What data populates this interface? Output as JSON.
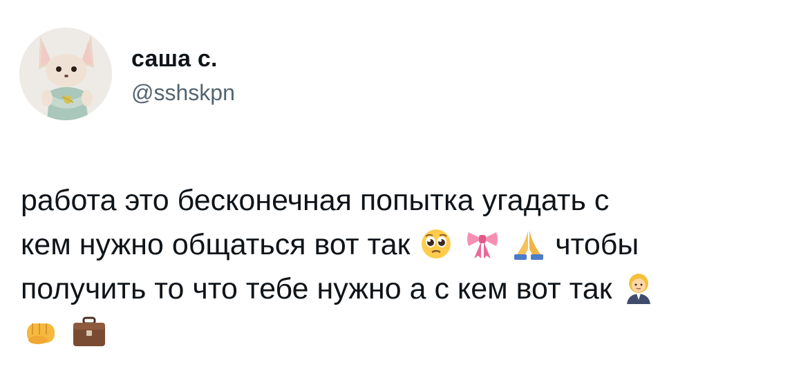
{
  "author": {
    "display_name": "саша с.",
    "handle": "@sshskpn"
  },
  "tweet": {
    "line1": "работа это бесконечная попытка угадать с",
    "line2_part1": "кем нужно общаться вот так",
    "line2_part2": "чтобы",
    "line3": "получить то что тебе нужно а с кем вот так",
    "emojis": {
      "pleading_face": "🥺",
      "ribbon": "🎀",
      "folded_hands": "🙏",
      "woman_office_worker": "👩‍💼",
      "oncoming_fist": "👊",
      "briefcase": "💼"
    }
  }
}
